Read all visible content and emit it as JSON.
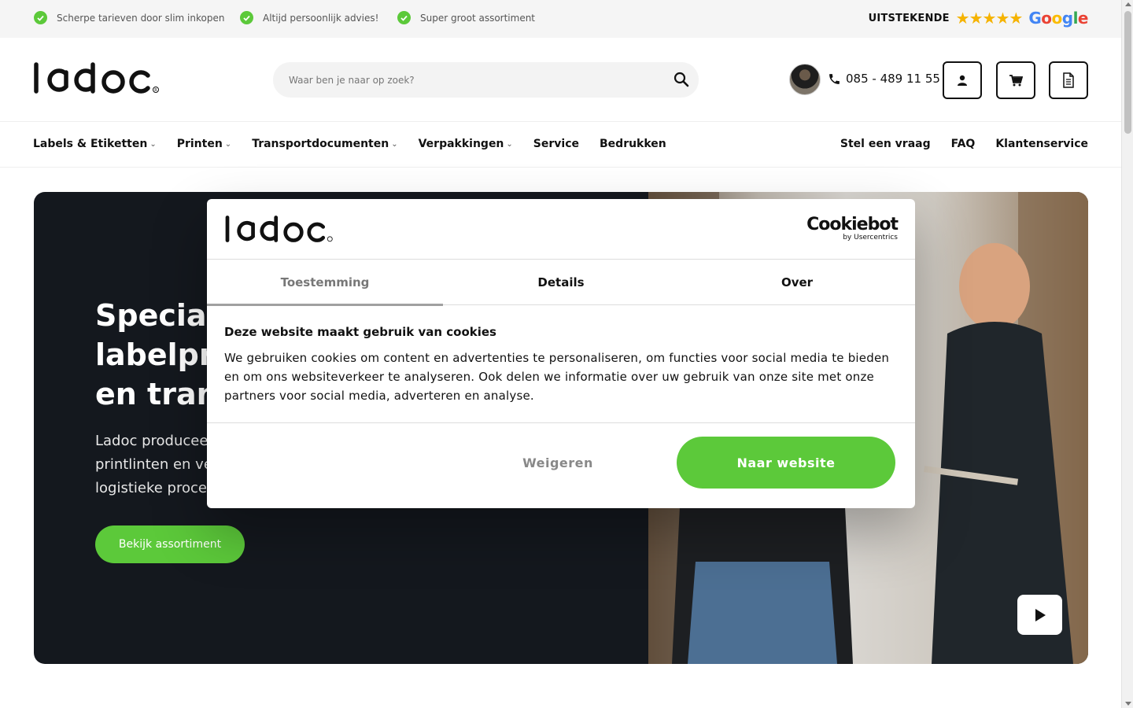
{
  "topbar": {
    "usps": [
      "Scherpe tarieven door slim inkopen",
      "Altijd persoonlijk advies!",
      "Super groot assortiment"
    ],
    "rating_label": "UITSTEKENDE",
    "stars": "★★★★★",
    "google": "Google"
  },
  "header": {
    "logo_alt": "ladoc",
    "search_placeholder": "Waar ben je naar op zoek?",
    "phone": "085 - 489 11 55"
  },
  "nav": {
    "left": [
      {
        "label": "Labels & Etiketten",
        "has_dropdown": true
      },
      {
        "label": "Printen",
        "has_dropdown": true
      },
      {
        "label": "Transportdocumenten",
        "has_dropdown": true
      },
      {
        "label": "Verpakkingen",
        "has_dropdown": true
      },
      {
        "label": "Service",
        "has_dropdown": false
      },
      {
        "label": "Bedrukken",
        "has_dropdown": false
      }
    ],
    "right": [
      "Stel een vraag",
      "FAQ",
      "Klantenservice"
    ]
  },
  "hero": {
    "title_lines": [
      "Speciali",
      "labelpri",
      "en trans"
    ],
    "text_lines": [
      "Ladoc producee",
      "printlinten en ve",
      "logistieke proces"
    ],
    "button": "Bekijk assortiment"
  },
  "cookie_dialog": {
    "provider_name": "Cookiebot",
    "provider_by": "by Usercentrics",
    "tabs": [
      "Toestemming",
      "Details",
      "Over"
    ],
    "active_tab": "Toestemming",
    "title": "Deze website maakt gebruik van cookies",
    "body": "We gebruiken cookies om content en advertenties te personaliseren, om functies voor social media te bieden en om ons websiteverkeer te analyseren. Ook delen we informatie over uw gebruik van onze site met onze partners voor social media, adverteren en analyse.",
    "decline": "Weigeren",
    "accept": "Naar website"
  },
  "colors": {
    "brand_green": "#5cc93a",
    "hero_dark": "#14181e",
    "text": "#111111"
  }
}
